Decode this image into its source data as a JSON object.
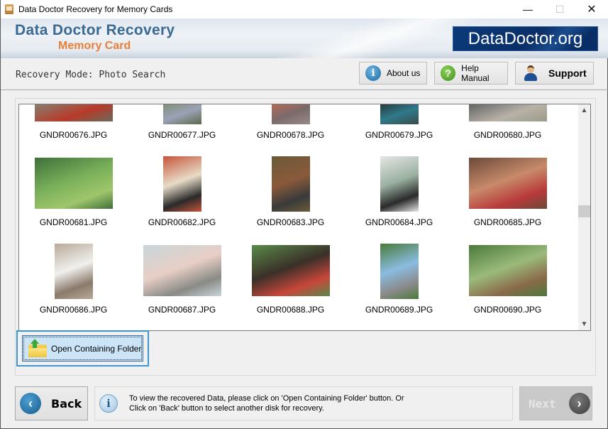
{
  "window": {
    "title": "Data Doctor Recovery for Memory Cards",
    "controls": {
      "minimize": "—",
      "maximize": "☐",
      "close": "✕"
    }
  },
  "header": {
    "brand_title": "Data Doctor Recovery",
    "brand_subtitle": "Memory Card",
    "site_logo": "DataDoctor.org"
  },
  "toolbar": {
    "mode_label": "Recovery Mode: Photo Search",
    "about_label": "About us",
    "help_label": "Help Manual",
    "support_label": "Support",
    "about_icon": "i",
    "help_icon": "?"
  },
  "gallery": {
    "files": [
      {
        "name": "GNDR00676.JPG",
        "colors": [
          "#6b6b5a",
          "#8a7a6a",
          "#b83a2a"
        ],
        "orient": "landscape",
        "partial": true
      },
      {
        "name": "GNDR00677.JPG",
        "colors": [
          "#5c6a48",
          "#7a8a66",
          "#9aa2b6"
        ],
        "orient": "portrait",
        "partial": true
      },
      {
        "name": "GNDR00678.JPG",
        "colors": [
          "#9a8a86",
          "#c56a52",
          "#7a6a6a"
        ],
        "orient": "portrait",
        "partial": true
      },
      {
        "name": "GNDR00679.JPG",
        "colors": [
          "#3a4a4a",
          "#2a2a2a",
          "#2f7a8a"
        ],
        "orient": "portrait",
        "partial": true
      },
      {
        "name": "GNDR00680.JPG",
        "colors": [
          "#9a9a86",
          "#6a6a6a",
          "#b8b2a8"
        ],
        "orient": "landscape",
        "partial": true
      },
      {
        "name": "GNDR00681.JPG",
        "colors": [
          "#3f6f3a",
          "#7ab05a",
          "#9fc66b"
        ],
        "orient": "landscape"
      },
      {
        "name": "GNDR00682.JPG",
        "colors": [
          "#c5543a",
          "#e8dcc8",
          "#2a2a2a"
        ],
        "orient": "portrait"
      },
      {
        "name": "GNDR00683.JPG",
        "colors": [
          "#6a5a3a",
          "#8a5a3a",
          "#3a3a3a"
        ],
        "orient": "portrait"
      },
      {
        "name": "GNDR00684.JPG",
        "colors": [
          "#e6e6e6",
          "#9ab0a0",
          "#2a2a2a"
        ],
        "orient": "portrait"
      },
      {
        "name": "GNDR00685.JPG",
        "colors": [
          "#6a4a3a",
          "#c88a6a",
          "#b83a3a"
        ],
        "orient": "landscape"
      },
      {
        "name": "GNDR00686.JPG",
        "colors": [
          "#b8aa98",
          "#f0f0ee",
          "#8a7a6a"
        ],
        "orient": "portrait"
      },
      {
        "name": "GNDR00687.JPG",
        "colors": [
          "#c8d6da",
          "#e8cfc6",
          "#8a8a86"
        ],
        "orient": "landscape"
      },
      {
        "name": "GNDR00688.JPG",
        "colors": [
          "#5a8a4a",
          "#3a3028",
          "#c8463a"
        ],
        "orient": "landscape"
      },
      {
        "name": "GNDR00689.JPG",
        "colors": [
          "#4a7a3a",
          "#8abce0",
          "#8a8a8a"
        ],
        "orient": "portrait"
      },
      {
        "name": "GNDR00690.JPG",
        "colors": [
          "#4a7a3a",
          "#9aba7a",
          "#8a6a4a"
        ],
        "orient": "landscape"
      }
    ],
    "scroll_position": 0.47
  },
  "actions": {
    "open_folder_label": "Open Containing Folder"
  },
  "footer": {
    "back_label": "Back",
    "next_label": "Next",
    "info_line1": "To view the recovered Data, please click on 'Open Containing Folder' button. Or",
    "info_line2": "Click on 'Back' button to select another disk for recovery.",
    "info_icon": "i",
    "back_arrow": "‹",
    "next_arrow": "›"
  }
}
